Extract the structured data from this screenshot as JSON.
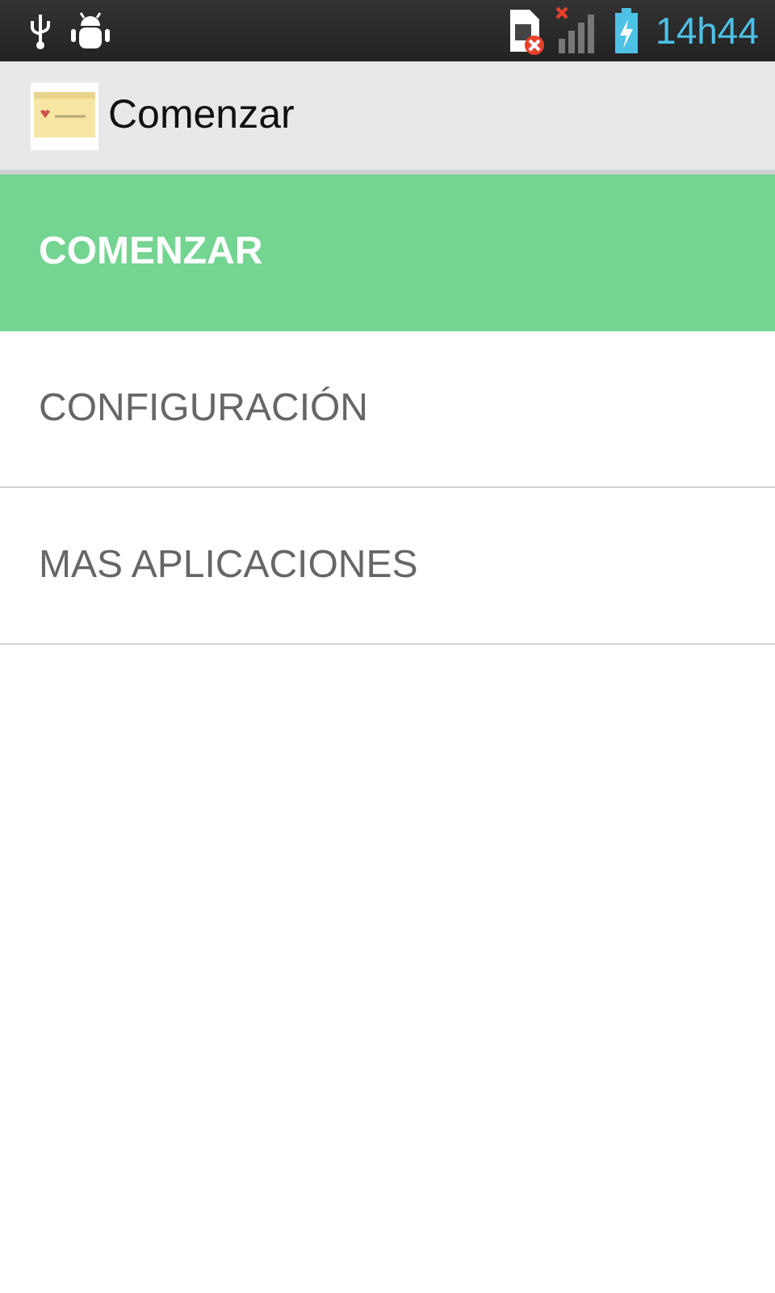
{
  "status_bar": {
    "time": "14h44"
  },
  "action_bar": {
    "title": "Comenzar"
  },
  "menu": [
    {
      "label": "COMENZAR",
      "selected": true
    },
    {
      "label": "CONFIGURACIÓN",
      "selected": false
    },
    {
      "label": "MAS APLICACIONES",
      "selected": false
    }
  ]
}
